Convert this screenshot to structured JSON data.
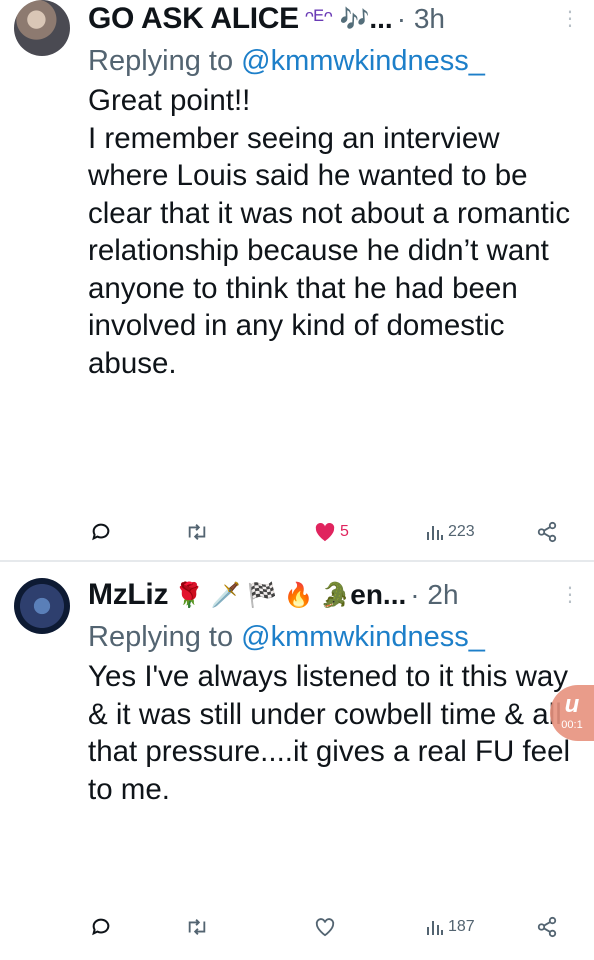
{
  "tweets": [
    {
      "name": "GO ASK ALICE",
      "emojis": "ᵔᴱᵔ 🎶",
      "ellipsis": "...",
      "time": "· 3h",
      "reply_prefix": "Replying to ",
      "reply_handle": "@kmmwkindness_",
      "text_lines": [
        "Great point!!",
        "I remember seeing an interview where Louis said he wanted to be clear that it was not about a romantic relationship because he didn’t want anyone to think that he had been involved in any kind of domestic abuse."
      ],
      "likes": "5",
      "views": "223",
      "liked": true
    },
    {
      "name": "MzLiz",
      "emojis": "🌹 🗡️ 🏁 🔥 🐊",
      "handle_fragment": "en...",
      "time": "· 2h",
      "reply_prefix": "Replying to ",
      "reply_handle": "@kmmwkindness_",
      "text_lines": [
        "Yes I've always listened to it this way & it was still under cowbell time & all that pressure....it gives a real FU feel to me."
      ],
      "likes": "",
      "views": "187",
      "liked": false
    }
  ],
  "overlay": {
    "logo": "и",
    "time": "00:1"
  },
  "icons": {
    "reply": "reply-icon",
    "retweet": "retweet-icon",
    "like": "heart-icon",
    "views": "views-icon",
    "share": "share-icon",
    "more": "more-icon"
  },
  "colors": {
    "like": "#e0245e",
    "link": "#1d7fc9",
    "muted": "#536471"
  }
}
